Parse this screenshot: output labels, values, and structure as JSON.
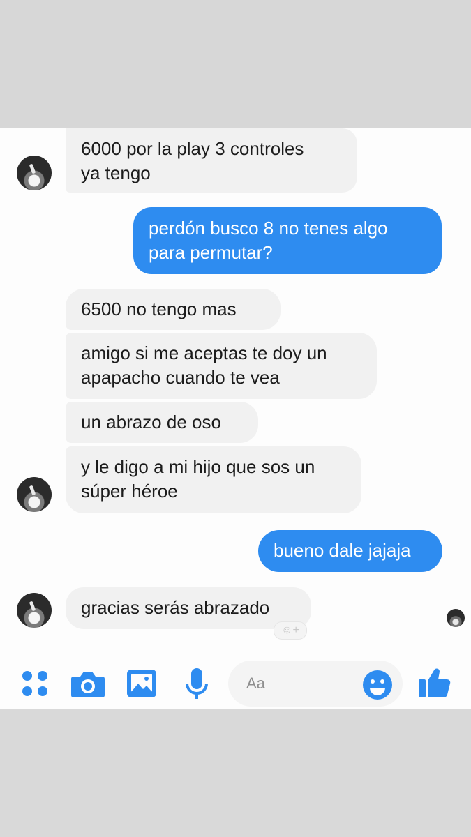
{
  "messages": [
    {
      "side": "in",
      "lines": [
        "6000 por la play 3 controles",
        "ya tengo"
      ]
    },
    {
      "side": "out",
      "lines": [
        "perdón busco 8 no tenes algo",
        "para permutar?"
      ]
    },
    {
      "side": "in",
      "lines": [
        "6500 no tengo mas"
      ]
    },
    {
      "side": "in",
      "lines": [
        "amigo si me aceptas te doy un",
        "apapacho cuando te vea"
      ]
    },
    {
      "side": "in",
      "lines": [
        "un abrazo de oso"
      ]
    },
    {
      "side": "in",
      "lines": [
        "y le digo a mi hijo que sos un",
        "súper héroe"
      ]
    },
    {
      "side": "out",
      "lines": [
        "bueno dale jajaja"
      ]
    },
    {
      "side": "in",
      "lines": [
        "gracias serás abrazado"
      ]
    }
  ],
  "reaction": {
    "icon": "add-reaction-icon",
    "label": "☺+"
  },
  "composer": {
    "placeholder": "Aa",
    "icons": [
      "more-dots-icon",
      "camera-icon",
      "gallery-icon",
      "microphone-icon",
      "emoji-icon",
      "thumbs-up-icon"
    ]
  },
  "colors": {
    "accent": "#2e8cf0",
    "incoming_bubble": "#f1f1f1",
    "background": "#fdfdfd",
    "frame": "#d7d7d7"
  }
}
